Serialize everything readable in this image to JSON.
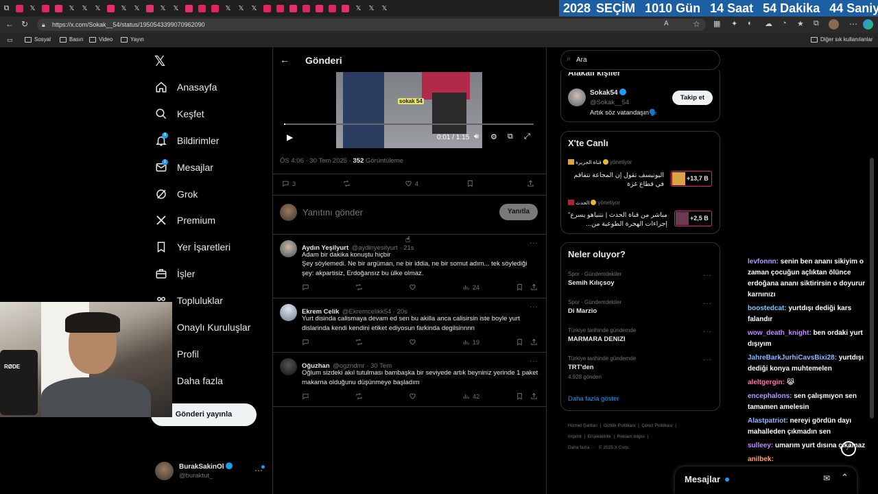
{
  "browser": {
    "url": "https://x.com/Sokak__54/status/1950543399070962090",
    "bookmarks": [
      "Sosyal",
      "Basın",
      "Video",
      "Yayın"
    ],
    "other_bookmarks": "Diğer sık kullanılanlar",
    "tab_colors": [
      "#e0245e",
      "#999",
      "#e0245e",
      "#e1306c",
      "#999",
      "#999",
      "#999",
      "#e1306c",
      "#999",
      "#999",
      "#e1306c",
      "#999",
      "#999",
      "#e1306c",
      "#e0245e",
      "#e0245e",
      "#999",
      "#999",
      "#999",
      "#e0245e",
      "#e0245e",
      "#e1306c",
      "#e0245e",
      "#e1306c",
      "#e0245e",
      "#e1306c",
      "#999",
      "#999",
      "#999"
    ]
  },
  "banner": {
    "year": "2028",
    "label": "SEÇİM",
    "days": "1010 Gün",
    "hours": "14 Saat",
    "minutes": "54 Dakika",
    "seconds": "44 Saniye"
  },
  "sidebar": {
    "items": [
      {
        "label": "Anasayfa",
        "icon": "home-icon"
      },
      {
        "label": "Keşfet",
        "icon": "search-icon"
      },
      {
        "label": "Bildirimler",
        "icon": "bell-icon",
        "badge": "8"
      },
      {
        "label": "Mesajlar",
        "icon": "mail-icon",
        "badge": "1"
      },
      {
        "label": "Grok",
        "icon": "grok-icon"
      },
      {
        "label": "Premium",
        "icon": "x-icon"
      },
      {
        "label": "Yer İşaretleri",
        "icon": "bookmark-icon"
      },
      {
        "label": "İşler",
        "icon": "briefcase-icon"
      },
      {
        "label": "Topluluklar",
        "icon": "people-icon"
      },
      {
        "label": "Onaylı Kuruluşlar",
        "icon": "bolt-icon"
      },
      {
        "label": "Profil",
        "icon": "person-icon"
      },
      {
        "label": "Daha fazla",
        "icon": "more-icon"
      }
    ],
    "post_button": "Gönderi yayınla",
    "account": {
      "name": "BurakSakinOl",
      "handle": "@buraktut_"
    }
  },
  "main": {
    "title": "Gönderi",
    "video": {
      "time": "0:01 / 1:15",
      "watermark": "sokak 54"
    },
    "meta": {
      "time": "ÖS 4:06 · 30 Tem 2025 · ",
      "views": "352",
      "views_label": " Görüntüleme"
    },
    "stats": {
      "replies": "3",
      "likes": "4"
    },
    "reply_placeholder": "Yanıtını gönder",
    "reply_button": "Yanıtla",
    "replies": [
      {
        "name": "Aydın Yeşilyurt",
        "handle": "@aydinyesilyurt · 21s",
        "text1": "Adam bir dakika konuştu hiçbir",
        "text2": "Şey söylemedi. Ne bir argüman, ne bir iddia, ne bir somut adım... tek söylediği şey: akpartisiz, Erdoğansız bu ülke olmaz.",
        "views": "24"
      },
      {
        "name": "Ekrem Celik",
        "handle": "@Ekremcelikk54 · 20s",
        "text1": "Yurt disinda calismaya devam ed sen bu akilla anca calisirsin iste boyle yurt dislarinda kendi kendini etiket ediyosun farkinda degilsinnnn",
        "text2": "",
        "views": "19"
      },
      {
        "name": "Oğuzhan",
        "handle": "@ogzndmr · 30 Tem",
        "text1": "Oğlum sizdeki akıl tutulması bambaşka bir seviyede artık beyniniz yerinde 1 paket makarna olduğunu düşünmeye başladım",
        "text2": "",
        "views": "42"
      }
    ]
  },
  "right": {
    "search_placeholder": "Ara",
    "related_title": "Alakalı kişiler",
    "related": {
      "name": "Sokak54",
      "handle": "@Sokak__54",
      "bio": "Artık söz vatandaşın🗣️",
      "follow": "Takip et"
    },
    "live_title": "X'te Canlı",
    "live": [
      {
        "source": "قناة الجزيرة",
        "role": "yönetiyor",
        "text": "اليونيسف تقول إن المجاعة تتفاقم في قطاع غزة",
        "count": "+13,7 B"
      },
      {
        "source": "الحدث",
        "role": "yönetiyor",
        "text": "مباشر من قناة الحدث | نتنياهو يسرع\" إجراءات الهجرة الطوعية من...",
        "count": "+2,5 B"
      }
    ],
    "trends_title": "Neler oluyor?",
    "trends": [
      {
        "context": "Spor · Gündemdekiler",
        "name": "Semih Kılıçsoy",
        "posts": ""
      },
      {
        "context": "Spor · Gündemdekiler",
        "name": "Di Marzio",
        "posts": ""
      },
      {
        "context": "Türkiye tarihinde gündemde",
        "name": "MARMARA DENIZI",
        "posts": ""
      },
      {
        "context": "Türkiye tarihinde gündemde",
        "name": "TRT'den",
        "posts": "4.928 gönderi"
      }
    ],
    "show_more": "Daha fazla göster",
    "footer": [
      "Hizmet Şartları",
      "Gizlilik Politikası",
      "Çerez Politikası",
      "Imprint",
      "Erişilebilirlik",
      "Reklam bilgisi",
      "Daha fazla ···",
      "© 2025 X Corp."
    ],
    "messages_title": "Mesajlar"
  },
  "chat": [
    {
      "user": "levfonnn:",
      "color": "#b49cff",
      "msg": "senin ben ananı sikiyim o zaman çocuğun açlıktan ölünce erdoğana ananı siktirirsin o doyurur karnınızı"
    },
    {
      "user": "boostedcat:",
      "color": "#7ec8ff",
      "msg": "yurtdışı dediği kars falandır"
    },
    {
      "user": "wow_death_knight:",
      "color": "#c08cff",
      "msg": "ben ordaki yurt dışıyım"
    },
    {
      "user": "JahreBarkJurhiCavsBixi28:",
      "color": "#8fb6ff",
      "msg": "yurtdışı dediği konya muhtemelen"
    },
    {
      "user": "aleltgergin:",
      "color": "#ff6fb0",
      "msg": "😹"
    },
    {
      "user": "encephalons:",
      "color": "#b49cff",
      "msg": "sen çalışmıyon sen tamamen amelesin"
    },
    {
      "user": "Alastpatriot:",
      "color": "#8fb6ff",
      "msg": "nereyi gördün dayı mahalleden çıkmadın sen"
    },
    {
      "user": "sulleey:",
      "color": "#c08cff",
      "msg": "umarım yurt dısına çıkamaz"
    },
    {
      "user": "anilbek:",
      "color": "#ff9f6b",
      "msg": ""
    }
  ]
}
